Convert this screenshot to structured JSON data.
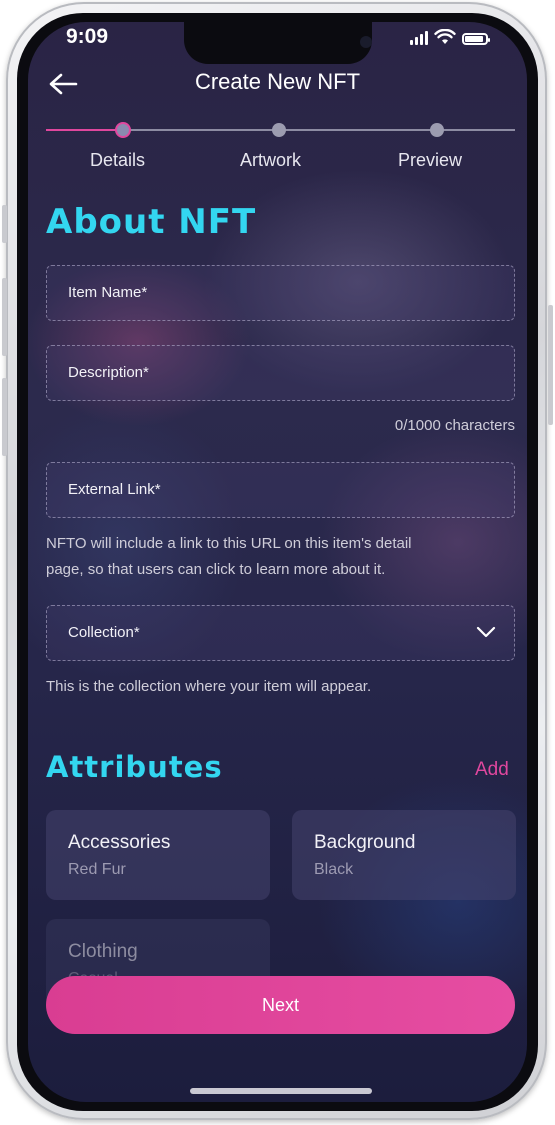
{
  "status_bar": {
    "time": "9:09"
  },
  "header": {
    "title": "Create New NFT",
    "back_icon": "arrow-left-icon"
  },
  "stepper": {
    "steps": [
      {
        "label": "Details",
        "active": true
      },
      {
        "label": "Artwork",
        "active": false
      },
      {
        "label": "Preview",
        "active": false
      }
    ]
  },
  "about": {
    "heading": "About NFT",
    "item_name_label": "Item Name*",
    "description_label": "Description*",
    "char_count": "0/1000 characters",
    "external_link_label": "External Link*",
    "external_link_help": [
      "NFTO will include a link to this URL on this item's detail",
      "page, so that users can click to learn more about it."
    ],
    "collection_label": "Collection*",
    "collection_help": "This is the collection where your item will appear."
  },
  "attributes": {
    "heading": "Attributes",
    "add_label": "Add",
    "items": [
      {
        "name": "Accessories",
        "value": "Red Fur"
      },
      {
        "name": "Background",
        "value": "Black"
      },
      {
        "name": "Clothing",
        "value": "Casual"
      }
    ]
  },
  "footer": {
    "next_label": "Next"
  },
  "colors": {
    "accent_pink": "#e0479e",
    "heading_cyan": "#33d6f0",
    "background": "#2a2445"
  }
}
